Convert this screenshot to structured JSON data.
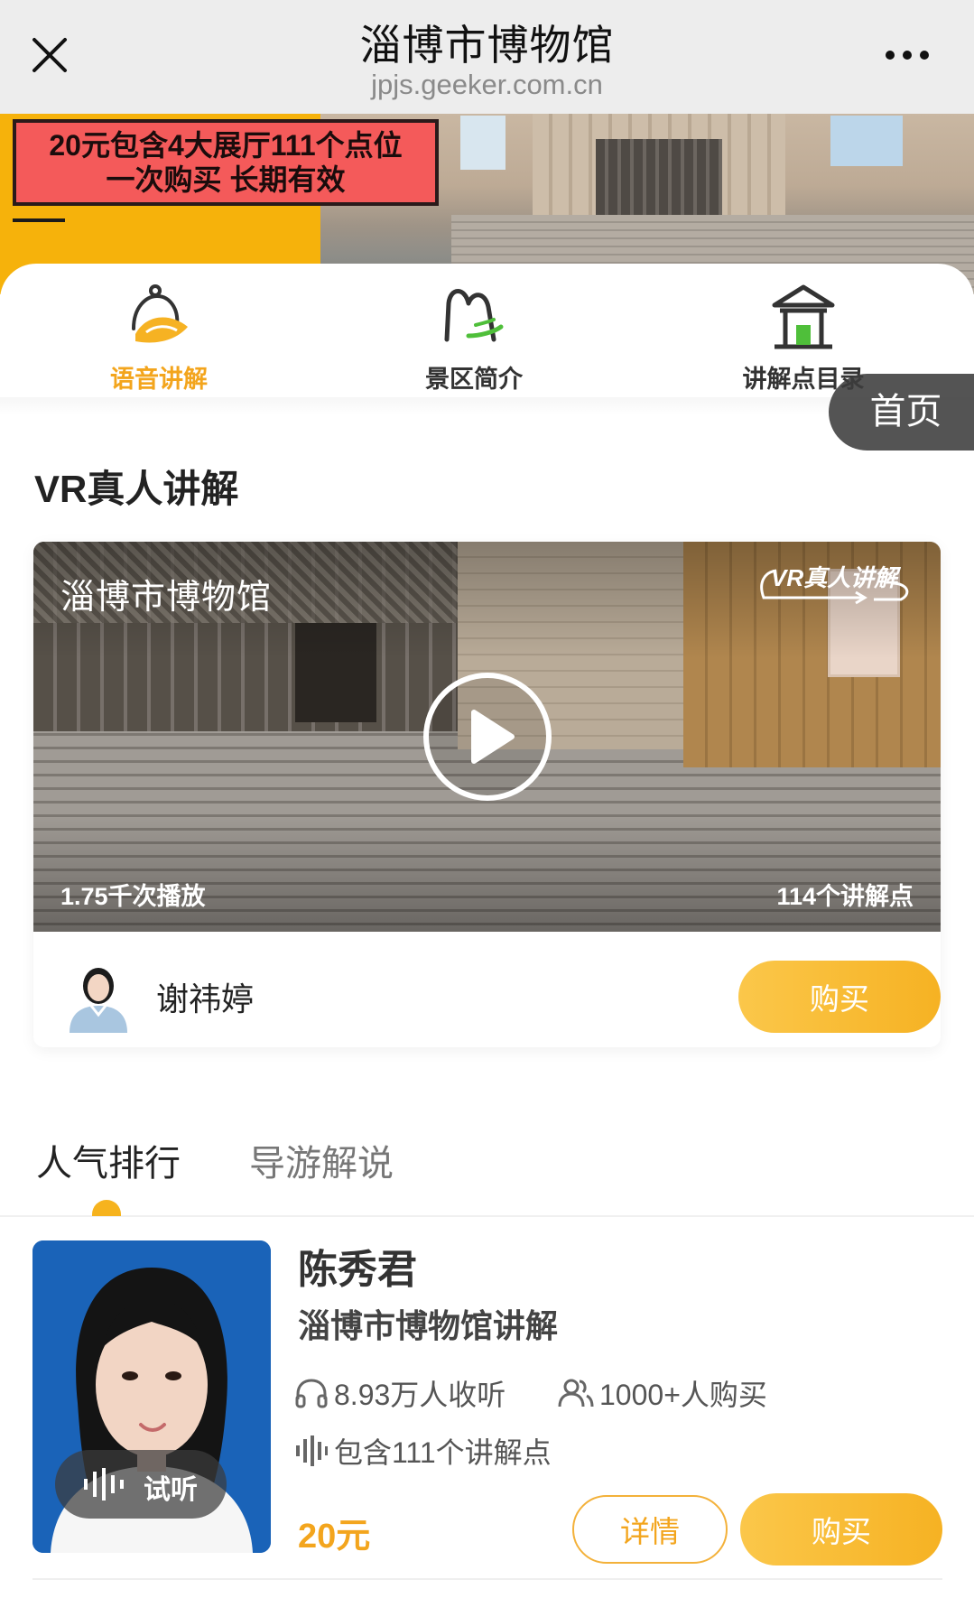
{
  "topbar": {
    "title": "淄博市博物馆",
    "url": "jpjs.geeker.com.cn"
  },
  "banner": {
    "promo_line1": "20元包含4大展厅111个点位",
    "promo_line2": "一次购买 长期有效"
  },
  "nav": {
    "items": [
      {
        "label": "语音讲解",
        "icon": "audio-guide-icon",
        "active": true
      },
      {
        "label": "景区简介",
        "icon": "scenic-intro-icon",
        "active": false
      },
      {
        "label": "讲解点目录",
        "icon": "pavilion-icon",
        "active": false
      }
    ],
    "home_button": "首页"
  },
  "vr": {
    "section_title": "VR真人讲解",
    "video_title": "淄博市博物馆",
    "badge": "VR真人讲解",
    "plays": "1.75千次播放",
    "points": "114个讲解点",
    "guide_name": "谢祎婷",
    "buy_label": "购买"
  },
  "tabs": [
    {
      "label": "人气排行",
      "active": true
    },
    {
      "label": "导游解说",
      "active": false
    }
  ],
  "guides": [
    {
      "name": "陈秀君",
      "title": "淄博市博物馆讲解",
      "listens": "8.93万人收听",
      "buyers": "1000+人购买",
      "points": "包含111个讲解点",
      "price": "20元",
      "listen_label": "试听",
      "detail_label": "详情",
      "buy_label": "购买"
    }
  ],
  "colors": {
    "accent": "#f6b223",
    "accent_text": "#f3a51d",
    "promo_red": "#f45a5a",
    "banner_yellow": "#f6b20b",
    "photo_blue": "#1a63b8"
  }
}
